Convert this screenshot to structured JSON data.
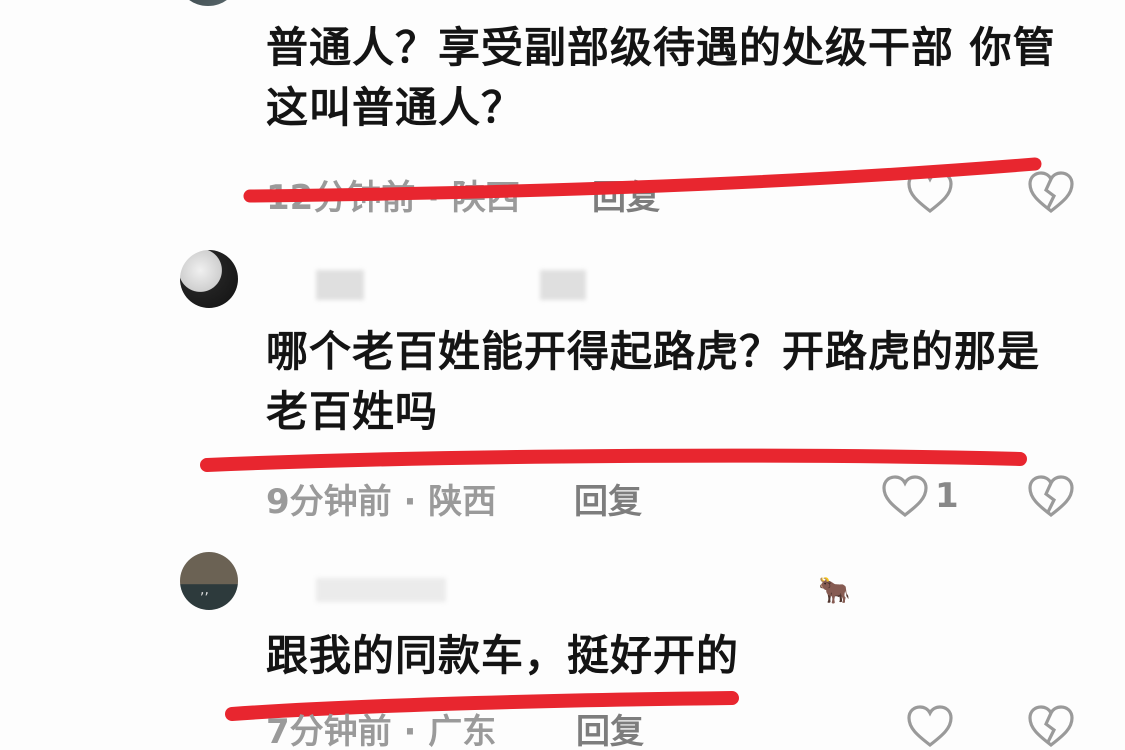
{
  "comments": [
    {
      "text": "普通人？享受副部级待遇的处级干部 你管这叫普通人？",
      "time": "12分钟前",
      "location": "陕西",
      "reply_label": "回复",
      "like_count": ""
    },
    {
      "text": "哪个老百姓能开得起路虎？开路虎的那是老百姓吗",
      "time": "9分钟前",
      "location": "陕西",
      "reply_label": "回复",
      "like_count": "1"
    },
    {
      "text": "跟我的同款车，挺好开的",
      "time": "7分钟前",
      "location": "广东",
      "reply_label": "回复",
      "like_count": "",
      "name_emoji": "🐂"
    }
  ],
  "colors": {
    "annotation_red": "#e8262f",
    "text": "#141414",
    "meta": "#9a9a9a"
  },
  "icons": {
    "like": "heart-outline-icon",
    "dislike": "broken-heart-icon"
  }
}
